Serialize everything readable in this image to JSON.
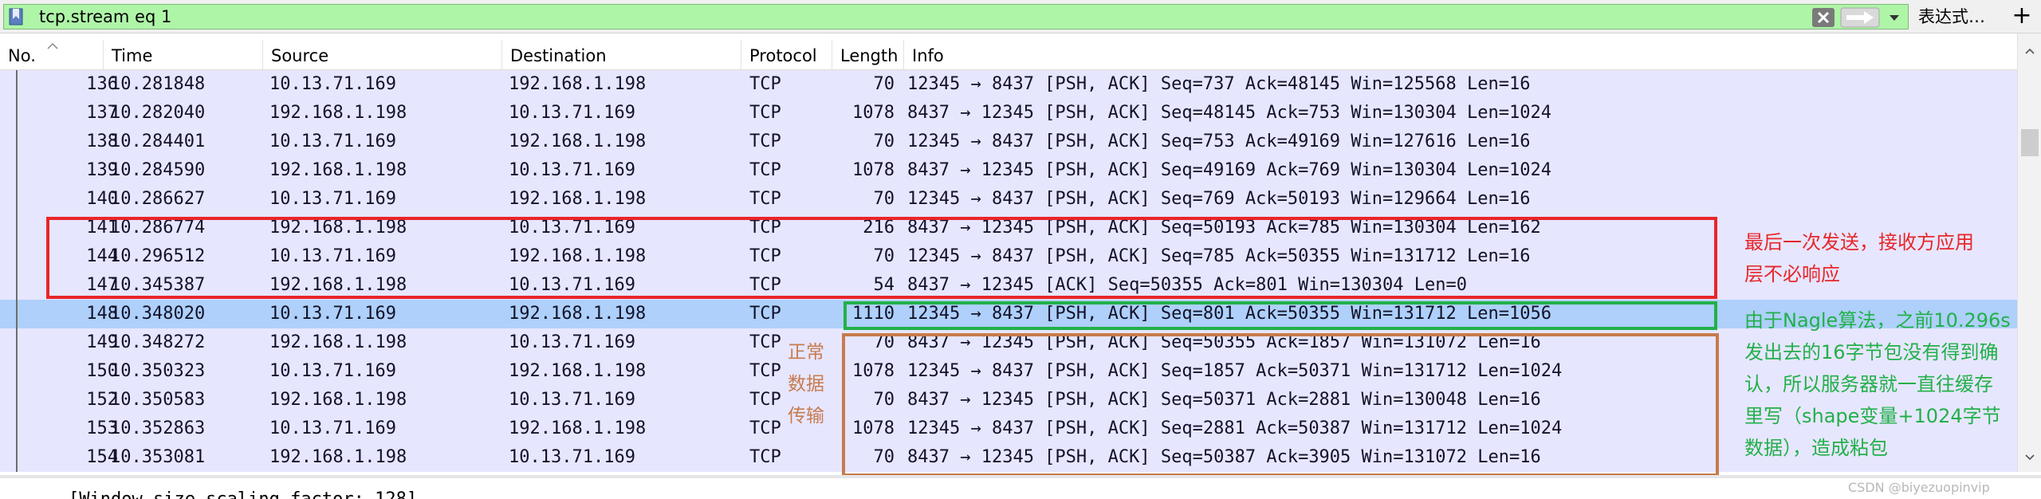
{
  "filter": {
    "value": "tcp.stream eq 1",
    "expression_label": "表达式…",
    "plus_label": "+"
  },
  "columns": {
    "no": "No.",
    "time": "Time",
    "source": "Source",
    "destination": "Destination",
    "protocol": "Protocol",
    "length": "Length",
    "info": "Info"
  },
  "packets": [
    {
      "no": "136",
      "time": "10.281848",
      "src": "10.13.71.169",
      "dst": "192.168.1.198",
      "proto": "TCP",
      "len": "70",
      "info": "12345 → 8437 [PSH, ACK] Seq=737 Ack=48145 Win=125568 Len=16"
    },
    {
      "no": "137",
      "time": "10.282040",
      "src": "192.168.1.198",
      "dst": "10.13.71.169",
      "proto": "TCP",
      "len": "1078",
      "info": "8437 → 12345 [PSH, ACK] Seq=48145 Ack=753 Win=130304 Len=1024"
    },
    {
      "no": "138",
      "time": "10.284401",
      "src": "10.13.71.169",
      "dst": "192.168.1.198",
      "proto": "TCP",
      "len": "70",
      "info": "12345 → 8437 [PSH, ACK] Seq=753 Ack=49169 Win=127616 Len=16"
    },
    {
      "no": "139",
      "time": "10.284590",
      "src": "192.168.1.198",
      "dst": "10.13.71.169",
      "proto": "TCP",
      "len": "1078",
      "info": "8437 → 12345 [PSH, ACK] Seq=49169 Ack=769 Win=130304 Len=1024"
    },
    {
      "no": "140",
      "time": "10.286627",
      "src": "10.13.71.169",
      "dst": "192.168.1.198",
      "proto": "TCP",
      "len": "70",
      "info": "12345 → 8437 [PSH, ACK] Seq=769 Ack=50193 Win=129664 Len=16"
    },
    {
      "no": "141",
      "time": "10.286774",
      "src": "192.168.1.198",
      "dst": "10.13.71.169",
      "proto": "TCP",
      "len": "216",
      "info": "8437 → 12345 [PSH, ACK] Seq=50193 Ack=785 Win=130304 Len=162"
    },
    {
      "no": "144",
      "time": "10.296512",
      "src": "10.13.71.169",
      "dst": "192.168.1.198",
      "proto": "TCP",
      "len": "70",
      "info": "12345 → 8437 [PSH, ACK] Seq=785 Ack=50355 Win=131712 Len=16"
    },
    {
      "no": "147",
      "time": "10.345387",
      "src": "192.168.1.198",
      "dst": "10.13.71.169",
      "proto": "TCP",
      "len": "54",
      "info": "8437 → 12345 [ACK] Seq=50355 Ack=801 Win=130304 Len=0"
    },
    {
      "no": "148",
      "time": "10.348020",
      "src": "10.13.71.169",
      "dst": "192.168.1.198",
      "proto": "TCP",
      "len": "1110",
      "info": "12345 → 8437 [PSH, ACK] Seq=801 Ack=50355 Win=131712 Len=1056"
    },
    {
      "no": "149",
      "time": "10.348272",
      "src": "192.168.1.198",
      "dst": "10.13.71.169",
      "proto": "TCP",
      "len": "70",
      "info": "8437 → 12345 [PSH, ACK] Seq=50355 Ack=1857 Win=131072 Len=16"
    },
    {
      "no": "150",
      "time": "10.350323",
      "src": "10.13.71.169",
      "dst": "192.168.1.198",
      "proto": "TCP",
      "len": "1078",
      "info": "12345 → 8437 [PSH, ACK] Seq=1857 Ack=50371 Win=131712 Len=1024"
    },
    {
      "no": "152",
      "time": "10.350583",
      "src": "192.168.1.198",
      "dst": "10.13.71.169",
      "proto": "TCP",
      "len": "70",
      "info": "8437 → 12345 [PSH, ACK] Seq=50371 Ack=2881 Win=130048 Len=16"
    },
    {
      "no": "153",
      "time": "10.352863",
      "src": "10.13.71.169",
      "dst": "192.168.1.198",
      "proto": "TCP",
      "len": "1078",
      "info": "12345 → 8437 [PSH, ACK] Seq=2881 Ack=50387 Win=131712 Len=1024"
    },
    {
      "no": "154",
      "time": "10.353081",
      "src": "192.168.1.198",
      "dst": "10.13.71.169",
      "proto": "TCP",
      "len": "70",
      "info": "8437 → 12345 [PSH, ACK] Seq=50387 Ack=3905 Win=131072 Len=16"
    }
  ],
  "selected_packet": "148",
  "detail": {
    "line": "[Window size scaling factor: 128]"
  },
  "annotations": {
    "red": [
      "最后一次发送，接收方应用",
      "层不必响应"
    ],
    "green": [
      "由于Nagle算法，之前10.296s",
      "发出去的16字节包没有得到确",
      "认，所以服务器就一直往缓存",
      "里写（shape变量+1024字节",
      "数据），造成粘包"
    ],
    "brown": [
      "正常",
      "数据",
      "传输"
    ]
  },
  "watermark": "CSDN @biyezuopinvip",
  "colors": {
    "filter_bg": "#aff5a8",
    "row_bg": "#e7e6ff",
    "row_selected": "#aed0fa",
    "red": "#e8262a",
    "green": "#22b04a",
    "brown": "#c77b4e"
  }
}
